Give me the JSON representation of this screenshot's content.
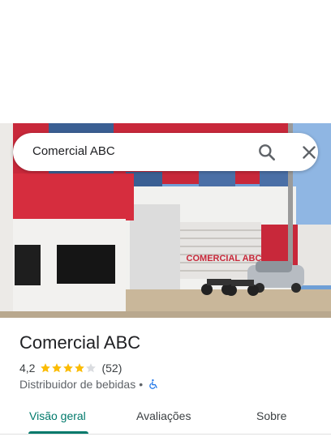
{
  "search": {
    "query": "Comercial ABC"
  },
  "place": {
    "name": "Comercial ABC",
    "rating": "4,2",
    "stars": 4.2,
    "review_count": "(52)",
    "category": "Distribuidor de bebidas",
    "separator": "•",
    "accessibility_icon": "wheelchair-icon"
  },
  "photo": {
    "sign_text": "COMERCIAL ABC"
  },
  "tabs": [
    {
      "label": "Visão geral",
      "active": true
    },
    {
      "label": "Avaliações",
      "active": false
    },
    {
      "label": "Sobre",
      "active": false
    }
  ],
  "colors": {
    "accent": "#00796b",
    "star": "#fbbc04",
    "star_empty": "#dadce0",
    "accessibility": "#1a73e8"
  }
}
